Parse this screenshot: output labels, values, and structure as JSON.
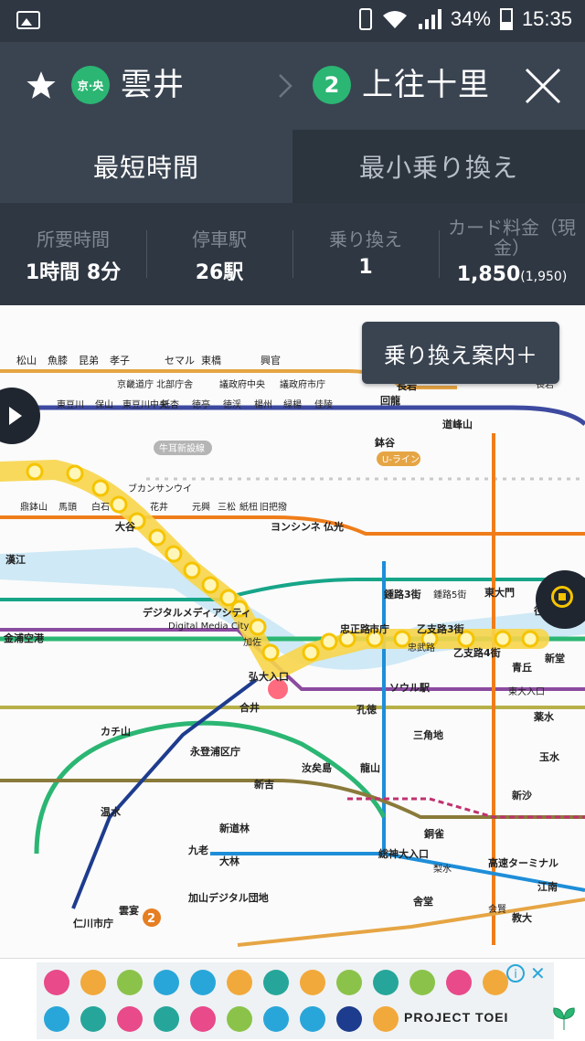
{
  "status_bar": {
    "battery": "34%",
    "time": "15:35",
    "icons": [
      "gallery-icon",
      "vibrate-icon",
      "wifi-icon",
      "signal-icon",
      "battery-icon"
    ]
  },
  "route_header": {
    "from_line_badge": "京·央",
    "from_station": "雲井",
    "to_line_badge": "2",
    "to_station": "上往十里",
    "line_color": "#2bb673"
  },
  "tabs": [
    {
      "label": "最短時間",
      "active": true
    },
    {
      "label": "最小乗り換え",
      "active": false
    }
  ],
  "stats": {
    "time_label": "所要時間",
    "time_value": "1時間 8分",
    "stops_label": "停車駅",
    "stops_value": "26駅",
    "transfer_label": "乗り換え",
    "transfer_value": "1",
    "fare_label": "カード料金（現金）",
    "fare_value": "1,850",
    "fare_cash": "(1,950)"
  },
  "map": {
    "guide_button": "乗り換え案内＋",
    "labels": {
      "l1": "松山",
      "l2": "魚膝",
      "l3": "昆弟",
      "l4": "孝子",
      "l5": "セマル",
      "l6": "東橋",
      "l7": "興官",
      "l8": "京畿道庁 北部庁舎",
      "l9": "議政府中央",
      "l10": "議政府市庁",
      "l11": "長岩",
      "l12": "回龍",
      "l13": "道峰山",
      "l14": "東豆川",
      "l15": "保山",
      "l16": "東豆川中央",
      "l17": "紙杏",
      "l18": "徳亭",
      "l19": "徳渓",
      "l20": "楊州",
      "l21": "緑楊",
      "l22": "佳陵",
      "l23": "鉢谷",
      "l24": "U-ライン",
      "l25": "牛耳新設線",
      "l26": "ブカンサンウイ",
      "l27": "大谷",
      "l28": "白石",
      "l29": "馬頭",
      "l30": "鼎鉢山",
      "l31": "花井",
      "l32": "元興",
      "l33": "三松",
      "l34": "紙杻",
      "l35": "旧把撥",
      "l36": "ヨンシンネ",
      "l37": "仏光",
      "l38": "漢江",
      "l39": "デジタルメディアシティ",
      "l40": "Digital Media City",
      "l41": "合井",
      "l42": "弘大入口",
      "l43": "忠正路",
      "l44": "市庁",
      "l45": "乙支路3街",
      "l46": "乙支路4街",
      "l47": "東大門",
      "l48": "鍾路3街",
      "l49": "鍾路5街",
      "l50": "ソウル駅",
      "l51": "孔徳",
      "l52": "永登浦区庁",
      "l53": "新道林",
      "l54": "大林",
      "l55": "九老",
      "l56": "加山デジタル団地",
      "l57": "新吉",
      "l58": "汝矣島",
      "l59": "龍山",
      "l60": "総神大入口",
      "l61": "銅雀",
      "l62": "高速ターミナル",
      "l63": "教大",
      "l64": "江南",
      "l65": "三角地",
      "l66": "新沙",
      "l67": "往十里",
      "l68": "玉水",
      "l69": "薬水",
      "l70": "青丘",
      "l71": "新堂",
      "l72": "カチ山",
      "l73": "温水",
      "l74": "仁川市庁",
      "l75": "雲宴",
      "l76": "金浦空港",
      "l77": "会賢",
      "l78": "舎堂",
      "l79": "梨水",
      "l80": "忠武路",
      "l81": "東大入口",
      "l82": "長岩",
      "l83": "加佐"
    }
  },
  "ad": {
    "brand": "PROJECT TOEI",
    "info": "i",
    "close": "✕"
  }
}
